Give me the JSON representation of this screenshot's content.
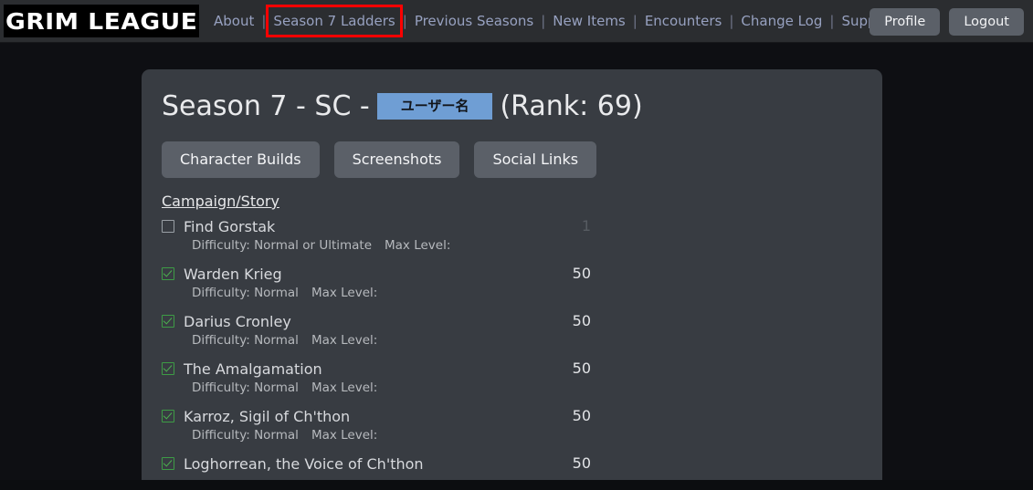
{
  "header": {
    "logo": "GRIM LEAGUE",
    "nav_links": [
      {
        "label": "About",
        "highlighted": false
      },
      {
        "label": "Season 7 Ladders",
        "highlighted": true
      },
      {
        "label": "Previous Seasons",
        "highlighted": false
      },
      {
        "label": "New Items",
        "highlighted": false
      },
      {
        "label": "Encounters",
        "highlighted": false
      },
      {
        "label": "Change Log",
        "highlighted": false
      },
      {
        "label": "Supporters",
        "highlighted": false
      }
    ],
    "separator": "|",
    "profile_button": "Profile",
    "logout_button": "Logout",
    "highlight_color": "#fe0000",
    "link_color": "#97a1c0"
  },
  "page": {
    "title_prefix": "Season 7 - SC -",
    "username_badge": "ユーザー名",
    "title_suffix": "(Rank: 69)",
    "badge_color": "#6f9ed4",
    "actions": [
      {
        "label": "Character Builds"
      },
      {
        "label": "Screenshots"
      },
      {
        "label": "Social Links"
      }
    ],
    "section_link": "Campaign/Story",
    "quests": [
      {
        "name": "Find Gorstak",
        "checked": false,
        "value": "1",
        "value_dim": true,
        "difficulty_label": "Difficulty:",
        "difficulty_value": "Normal or Ultimate",
        "max_level_label": "Max Level:",
        "max_level_value": ""
      },
      {
        "name": "Warden Krieg",
        "checked": true,
        "value": "50",
        "value_dim": false,
        "difficulty_label": "Difficulty:",
        "difficulty_value": "Normal",
        "max_level_label": "Max Level:",
        "max_level_value": ""
      },
      {
        "name": "Darius Cronley",
        "checked": true,
        "value": "50",
        "value_dim": false,
        "difficulty_label": "Difficulty:",
        "difficulty_value": "Normal",
        "max_level_label": "Max Level:",
        "max_level_value": ""
      },
      {
        "name": "The Amalgamation",
        "checked": true,
        "value": "50",
        "value_dim": false,
        "difficulty_label": "Difficulty:",
        "difficulty_value": "Normal",
        "max_level_label": "Max Level:",
        "max_level_value": ""
      },
      {
        "name": "Karroz, Sigil of Ch'thon",
        "checked": true,
        "value": "50",
        "value_dim": false,
        "difficulty_label": "Difficulty:",
        "difficulty_value": "Normal",
        "max_level_label": "Max Level:",
        "max_level_value": ""
      },
      {
        "name": "Loghorrean, the Voice of Ch'thon",
        "checked": true,
        "value": "50",
        "value_dim": false,
        "difficulty_label": "",
        "difficulty_value": "",
        "max_level_label": "",
        "max_level_value": ""
      }
    ]
  }
}
